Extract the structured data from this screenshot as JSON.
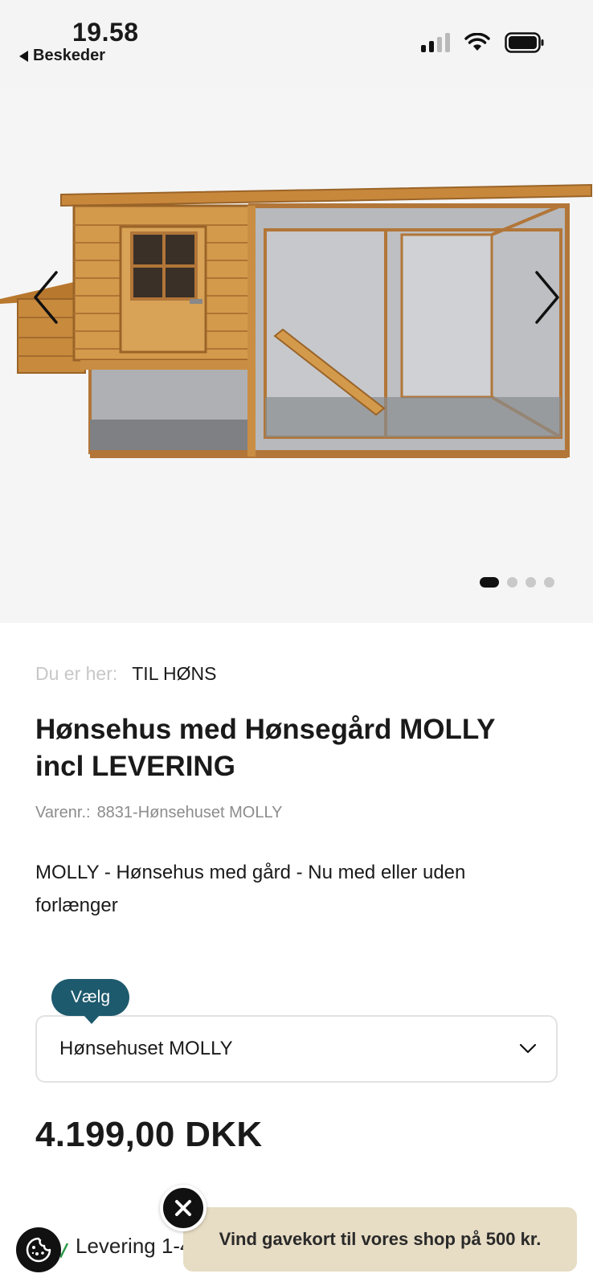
{
  "status_bar": {
    "time": "19.58",
    "back_app": "Beskeder",
    "icons": [
      "cellular-signal-icon",
      "wifi-icon",
      "battery-icon"
    ]
  },
  "gallery": {
    "slide_count": 4,
    "active_slide": 1,
    "icons": [
      "chevron-left-icon",
      "chevron-right-icon"
    ]
  },
  "breadcrumb": {
    "label": "Du er her:",
    "current": "TIL HØNS"
  },
  "product": {
    "title": "Hønsehus med Hønsegård MOLLY incl LEVERING",
    "sku_label": "Varenr.:",
    "sku_value": "8831-Hønsehuset MOLLY",
    "description": "MOLLY - Hønsehus med gård - Nu med eller uden forlænger",
    "variant_tooltip": "Vælg",
    "variant_selected": "Hønsehuset MOLLY",
    "price": "4.199,00 DKK"
  },
  "bottom": {
    "delivery_text": "Levering 1-4",
    "giftcard_banner": "Vind gavekort til vores shop på 500 kr.",
    "icons": [
      "cookie-icon",
      "close-icon",
      "truck-icon"
    ]
  },
  "colors": {
    "variant_tooltip_bg": "#1e5a6e",
    "banner_bg": "#e7dcc4",
    "gallery_bg": "#f5f5f5"
  }
}
